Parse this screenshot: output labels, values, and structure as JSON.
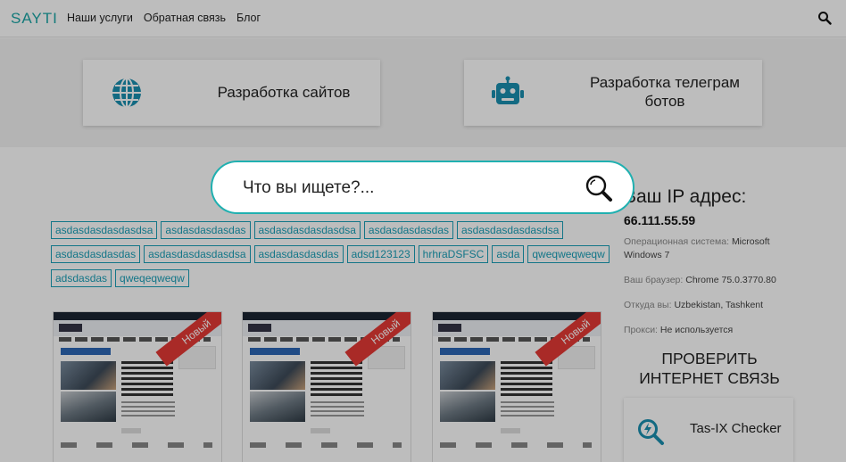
{
  "header": {
    "logo": "SAYTI",
    "nav": [
      "Наши услуги",
      "Обратная связь",
      "Блог"
    ]
  },
  "services": [
    {
      "label": "Разработка сайтов",
      "icon": "globe-icon"
    },
    {
      "label": "Разработка телеграм ботов",
      "icon": "robot-icon"
    }
  ],
  "search": {
    "placeholder": "Что вы ищете?..."
  },
  "tags": [
    "asdasdasdasdasdsa",
    "asdasdasdasdas",
    "asdasdasdasdasdsa",
    "asdasdasdasdas",
    "asdasdasdasdasdsa",
    "asdasdasdasdas",
    "asdasdasdasdasdsa",
    "asdasdasdasdas",
    "adsd123123",
    "hrhraDSFSC",
    "asda",
    "qweqweqweqw",
    "adsdasdas",
    "qweqeqweqw"
  ],
  "thumbnails": [
    {
      "ribbon": "Новый"
    },
    {
      "ribbon": "Новый"
    },
    {
      "ribbon": "Новый"
    }
  ],
  "sidebar": {
    "ip_title": "Ваш IP адрес:",
    "ip": "66.111.55.59",
    "os_label": "Операционная система:",
    "os_value": "Microsoft Windows 7",
    "browser_label": "Ваш браузер:",
    "browser_value": "Chrome 75.0.3770.80",
    "from_label": "Откуда вы:",
    "from_value": "Uzbekistan, Tashkent",
    "proxy_label": "Прокси:",
    "proxy_value": "Не используется",
    "check_title": "ПРОВЕРИТЬ ИНТЕРНЕТ СВЯЗЬ",
    "tasix_label": "Tas-IX Checker"
  },
  "colors": {
    "accent": "#1aa0b8",
    "ribbon": "#e53935",
    "search_border": "#20b0b0"
  }
}
